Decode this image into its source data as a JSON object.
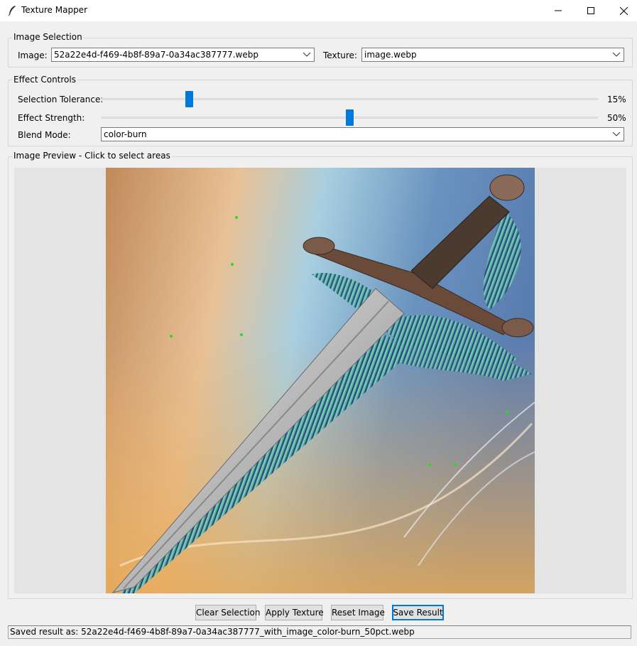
{
  "window": {
    "title": "Texture Mapper",
    "controls": [
      "minimize-icon",
      "maximize-icon",
      "close-icon"
    ]
  },
  "image_selection": {
    "legend": "Image Selection",
    "image_label": "Image:",
    "image_value": "52a22e4d-f469-4b8f-89a7-0a34ac387777.webp",
    "texture_label": "Texture:",
    "texture_value": "image.webp"
  },
  "effect_controls": {
    "legend": "Effect Controls",
    "tolerance_label": "Selection Tolerance:",
    "tolerance_value": "15%",
    "tolerance_level": 0.15,
    "strength_label": "Effect Strength:",
    "strength_value": "50%",
    "strength_level": 0.5,
    "blend_label": "Blend Mode:",
    "blend_value": "color-burn"
  },
  "preview": {
    "legend": "Image Preview - Click to select areas",
    "image_description_icon": "sword-image"
  },
  "buttons": {
    "clear": "Clear Selection",
    "apply": "Apply Texture",
    "reset": "Reset Image",
    "save": "Save Result"
  },
  "status": "Saved result as: 52a22e4d-f469-4b8f-89a7-0a34ac387777_with_image_color-burn_50pct.webp",
  "colors": {
    "accent": "#0078d7",
    "selection_point": "#22dd22"
  }
}
